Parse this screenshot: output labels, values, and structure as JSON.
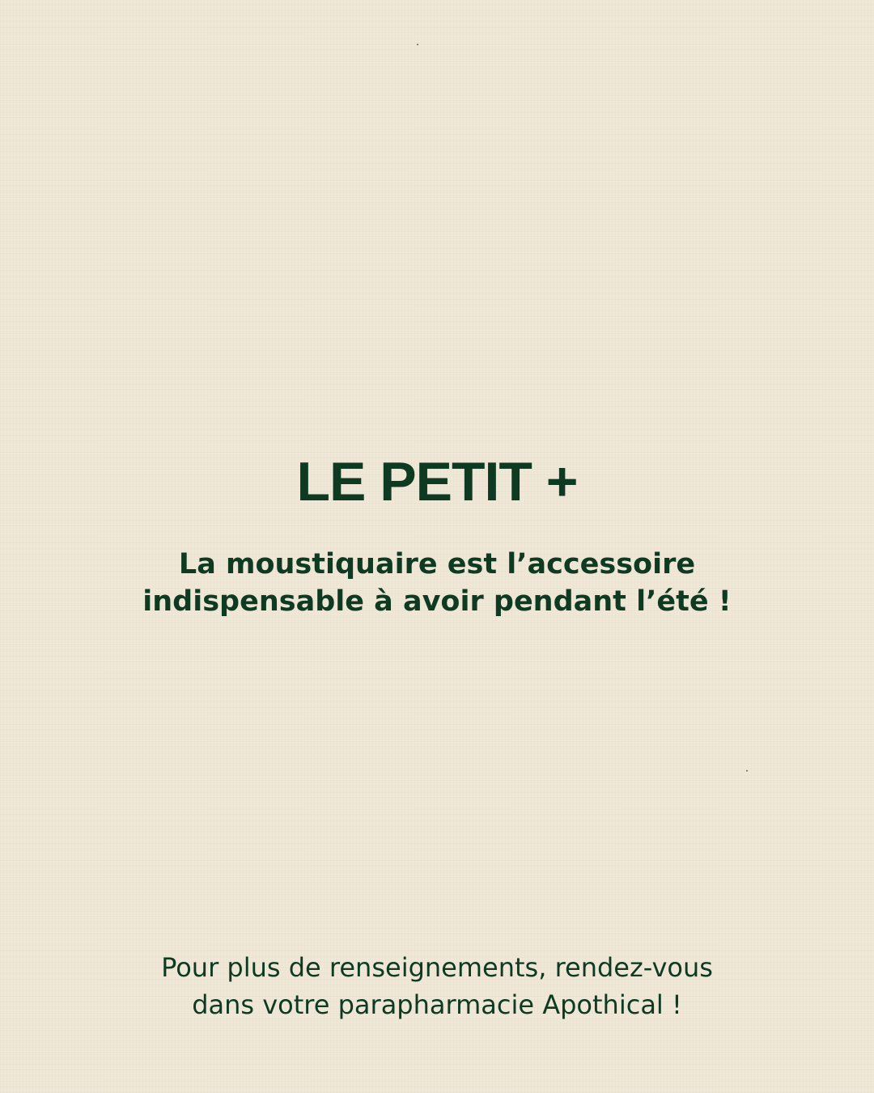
{
  "theme": {
    "background": "#efe7d6",
    "text_color": "#0f3a22"
  },
  "heading": {
    "title": "LE PETIT +"
  },
  "message": {
    "lines": [
      "La moustiquaire est l’accessoire",
      "indispensable à avoir pendant l’été !"
    ]
  },
  "footer": {
    "lines": [
      "Pour plus de renseignements, rendez-vous",
      "dans votre parapharmacie Apothical !"
    ]
  }
}
